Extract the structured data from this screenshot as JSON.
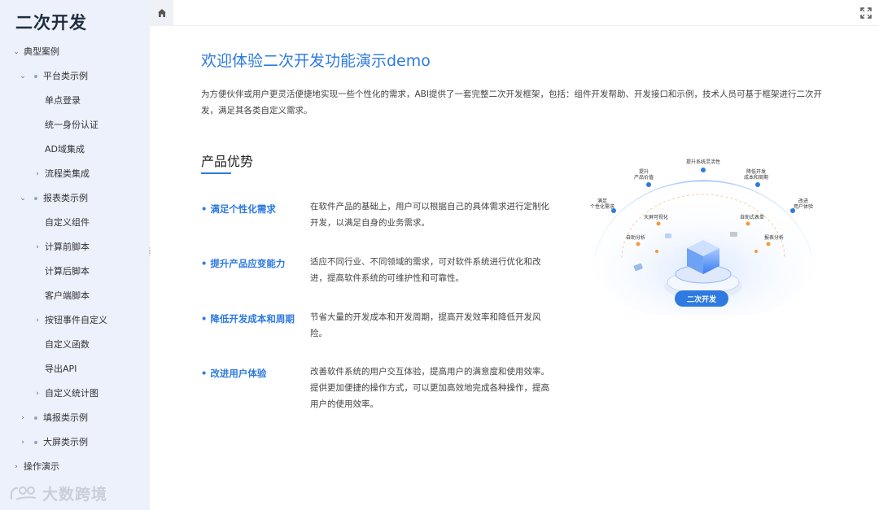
{
  "sidebar": {
    "app_title": "二次开发",
    "items": [
      {
        "label": "典型案例",
        "level": 0,
        "arrow": "⌄"
      },
      {
        "label": "平台类示例",
        "level": 1,
        "arrow": "⌄",
        "dot": true
      },
      {
        "label": "单点登录",
        "level": 2
      },
      {
        "label": "统一身份认证",
        "level": 2
      },
      {
        "label": "AD域集成",
        "level": 2
      },
      {
        "label": "流程类集成",
        "level": 2,
        "arrow": "›"
      },
      {
        "label": "报表类示例",
        "level": 1,
        "arrow": "⌄",
        "dot": true
      },
      {
        "label": "自定义组件",
        "level": 2
      },
      {
        "label": "计算前脚本",
        "level": 2,
        "arrow": "›"
      },
      {
        "label": "计算后脚本",
        "level": 2
      },
      {
        "label": "客户端脚本",
        "level": 2
      },
      {
        "label": "按钮事件自定义",
        "level": 2,
        "arrow": "›"
      },
      {
        "label": "自定义函数",
        "level": 2
      },
      {
        "label": "导出API",
        "level": 2
      },
      {
        "label": "自定义统计图",
        "level": 2,
        "arrow": "›"
      },
      {
        "label": "填报类示例",
        "level": 1,
        "arrow": "›",
        "dot": true
      },
      {
        "label": "大屏类示例",
        "level": 1,
        "arrow": "›",
        "dot": true
      },
      {
        "label": "操作演示",
        "level": 0,
        "arrow": "›"
      }
    ],
    "logo_text": "大数跨境"
  },
  "topbar": {
    "home_icon": "home-icon",
    "expand_icon": "fullscreen-icon"
  },
  "main": {
    "title": "欢迎体验二次开发功能演示demo",
    "intro": "为方便伙伴或用户更灵活便捷地实现一些个性化的需求，ABI提供了一套完整二次开发框架，包括：组件开发帮助、开发接口和示例，技术人员可基于框架进行二次开发，满足其各类自定义需求。",
    "section_title": "产品优势",
    "features": [
      {
        "name": "• 满足个性化需求",
        "desc": "在软件产品的基础上，用户可以根据自己的具体需求进行定制化开发，以满足自身的业务需求。"
      },
      {
        "name": "• 提升产品应变能力",
        "desc": "适应不同行业、不同领域的需求，可对软件系统进行优化和改进，提高软件系统的可维护性和可靠性。"
      },
      {
        "name": "• 降低开发成本和周期",
        "desc": "节省大量的开发成本和开发周期，提高开发效率和降低开发风险。"
      },
      {
        "name": "• 改进用户体验",
        "desc": "改善软件系统的用户交互体验，提高用户的满意度和使用效率。提供更加便捷的操作方式，可以更加高效地完成各种操作，提高用户的使用效率。"
      }
    ]
  },
  "illustration": {
    "center_label": "二次开发",
    "outer_labels": {
      "top": "提升系统灵活性",
      "left_upper_1": "提升",
      "left_upper_2": "产品价值",
      "right_upper_1": "降低开发",
      "right_upper_2": "成本和周期",
      "left_1": "满足",
      "left_2": "个性化需求",
      "right_1": "改进",
      "right_2": "用户体验"
    },
    "inner_labels": {
      "a": "大屏可视化",
      "b": "自助式表单",
      "c": "自助分析",
      "d": "报表分析"
    },
    "accent_color": "#2e7ae0"
  }
}
